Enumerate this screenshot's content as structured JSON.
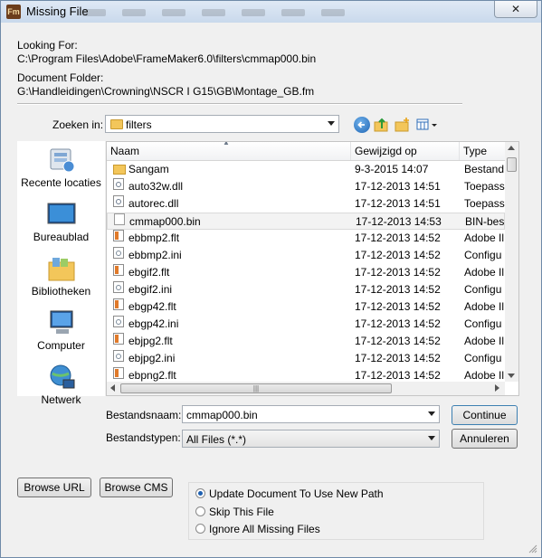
{
  "window": {
    "app_icon": "Fm",
    "title": "Missing File",
    "close_glyph": "✕"
  },
  "info": {
    "looking_for_label": "Looking For:",
    "looking_for_value": "C:\\Program Files\\Adobe\\FrameMaker6.0\\filters\\cmmap000.bin",
    "document_folder_label": "Document Folder:",
    "document_folder_value": "G:\\Handleidingen\\Crowning\\NSCR I G15\\GB\\Montage_GB.fm"
  },
  "lookin": {
    "label": "Zoeken in:",
    "value": "filters"
  },
  "toolbar_icons": [
    "back-icon",
    "up-folder-icon",
    "new-folder-icon",
    "view-menu-icon"
  ],
  "places": [
    {
      "label": "Recente locaties",
      "icon": "recent-places-icon"
    },
    {
      "label": "Bureaublad",
      "icon": "desktop-icon"
    },
    {
      "label": "Bibliotheken",
      "icon": "libraries-icon"
    },
    {
      "label": "Computer",
      "icon": "computer-icon"
    },
    {
      "label": "Netwerk",
      "icon": "network-icon"
    }
  ],
  "columns": {
    "name": "Naam",
    "modified": "Gewijzigd op",
    "type": "Type"
  },
  "files": [
    {
      "name": "Sangam",
      "modified": "9-3-2015 14:07",
      "type": "Bestand",
      "kind": "folder"
    },
    {
      "name": "auto32w.dll",
      "modified": "17-12-2013 14:51",
      "type": "Toepass",
      "kind": "dll"
    },
    {
      "name": "autorec.dll",
      "modified": "17-12-2013 14:51",
      "type": "Toepass",
      "kind": "dll"
    },
    {
      "name": "cmmap000.bin",
      "modified": "17-12-2013 14:53",
      "type": "BIN-bes",
      "kind": "bin",
      "selected": true
    },
    {
      "name": "ebbmp2.flt",
      "modified": "17-12-2013 14:52",
      "type": "Adobe Il",
      "kind": "flt"
    },
    {
      "name": "ebbmp2.ini",
      "modified": "17-12-2013 14:52",
      "type": "Configu",
      "kind": "ini"
    },
    {
      "name": "ebgif2.flt",
      "modified": "17-12-2013 14:52",
      "type": "Adobe Il",
      "kind": "flt"
    },
    {
      "name": "ebgif2.ini",
      "modified": "17-12-2013 14:52",
      "type": "Configu",
      "kind": "ini"
    },
    {
      "name": "ebgp42.flt",
      "modified": "17-12-2013 14:52",
      "type": "Adobe Il",
      "kind": "flt"
    },
    {
      "name": "ebgp42.ini",
      "modified": "17-12-2013 14:52",
      "type": "Configu",
      "kind": "ini"
    },
    {
      "name": "ebjpg2.flt",
      "modified": "17-12-2013 14:52",
      "type": "Adobe Il",
      "kind": "flt"
    },
    {
      "name": "ebjpg2.ini",
      "modified": "17-12-2013 14:52",
      "type": "Configu",
      "kind": "ini"
    },
    {
      "name": "ebpng2.flt",
      "modified": "17-12-2013 14:52",
      "type": "Adobe Il",
      "kind": "flt"
    }
  ],
  "filename": {
    "label": "Bestandsnaam:",
    "value": "cmmap000.bin"
  },
  "filetype": {
    "label": "Bestandstypen:",
    "value": "All Files (*.*)"
  },
  "buttons": {
    "continue": "Continue",
    "cancel": "Annuleren",
    "browse_url": "Browse URL",
    "browse_cms": "Browse CMS"
  },
  "options": [
    {
      "label": "Update Document To Use New Path",
      "checked": true
    },
    {
      "label": "Skip This File",
      "checked": false
    },
    {
      "label": "Ignore All Missing Files",
      "checked": false
    }
  ]
}
